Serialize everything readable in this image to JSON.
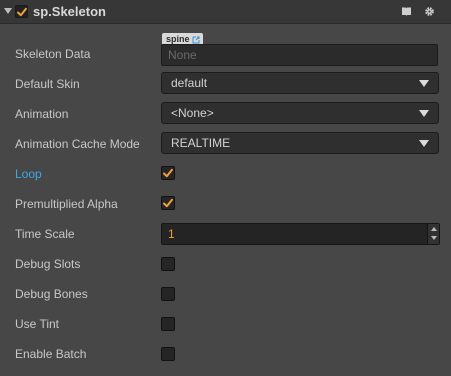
{
  "header": {
    "title": "sp.Skeleton",
    "enabled": true,
    "icons": [
      "help-book-icon",
      "gear-icon"
    ]
  },
  "skeleton_data": {
    "label": "Skeleton Data",
    "asset_tag": "spine",
    "placeholder": "None"
  },
  "default_skin": {
    "label": "Default Skin",
    "value": "default"
  },
  "animation": {
    "label": "Animation",
    "value": "<None>"
  },
  "cache_mode": {
    "label": "Animation Cache Mode",
    "value": "REALTIME"
  },
  "loop": {
    "label": "Loop",
    "checked": true
  },
  "premultiplied_alpha": {
    "label": "Premultiplied Alpha",
    "checked": true
  },
  "time_scale": {
    "label": "Time Scale",
    "value": "1"
  },
  "debug_slots": {
    "label": "Debug Slots",
    "checked": false
  },
  "debug_bones": {
    "label": "Debug Bones",
    "checked": false
  },
  "use_tint": {
    "label": "Use Tint",
    "checked": false
  },
  "enable_batch": {
    "label": "Enable Batch",
    "checked": false
  },
  "colors": {
    "checkmark": "#f5a03a",
    "highlight_label": "#3ea7ea",
    "number_value": "#f09c37"
  }
}
